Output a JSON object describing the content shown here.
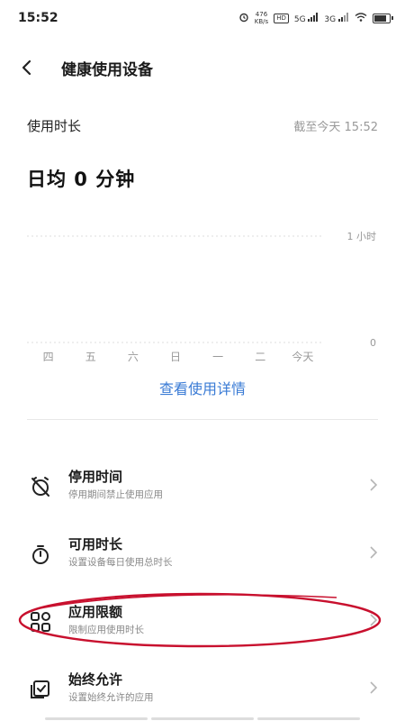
{
  "status_bar": {
    "time": "15:52",
    "speed_value": "476",
    "speed_unit": "KB/s",
    "network1": "5G",
    "network2": "3G"
  },
  "header": {
    "title": "健康使用设备"
  },
  "usage": {
    "label": "使用时长",
    "as_of": "截至今天 15:52",
    "daily_average": "日均 0 分钟"
  },
  "chart_data": {
    "type": "bar",
    "categories": [
      "四",
      "五",
      "六",
      "日",
      "一",
      "二",
      "今天"
    ],
    "values": [
      0,
      0,
      0,
      0,
      0,
      0,
      0
    ],
    "y_ticks": [
      "1 小时",
      "0"
    ],
    "ylim": [
      0,
      1
    ]
  },
  "details_link": "查看使用详情",
  "menu": [
    {
      "title": "停用时间",
      "subtitle": "停用期间禁止使用应用",
      "icon": "alarm-off-icon"
    },
    {
      "title": "可用时长",
      "subtitle": "设置设备每日使用总时长",
      "icon": "stopwatch-icon"
    },
    {
      "title": "应用限额",
      "subtitle": "限制应用使用时长",
      "icon": "apps-grid-icon"
    },
    {
      "title": "始终允许",
      "subtitle": "设置始终允许的应用",
      "icon": "allow-app-icon"
    }
  ],
  "colors": {
    "link": "#3a7bd5",
    "highlight": "#c8102e"
  }
}
